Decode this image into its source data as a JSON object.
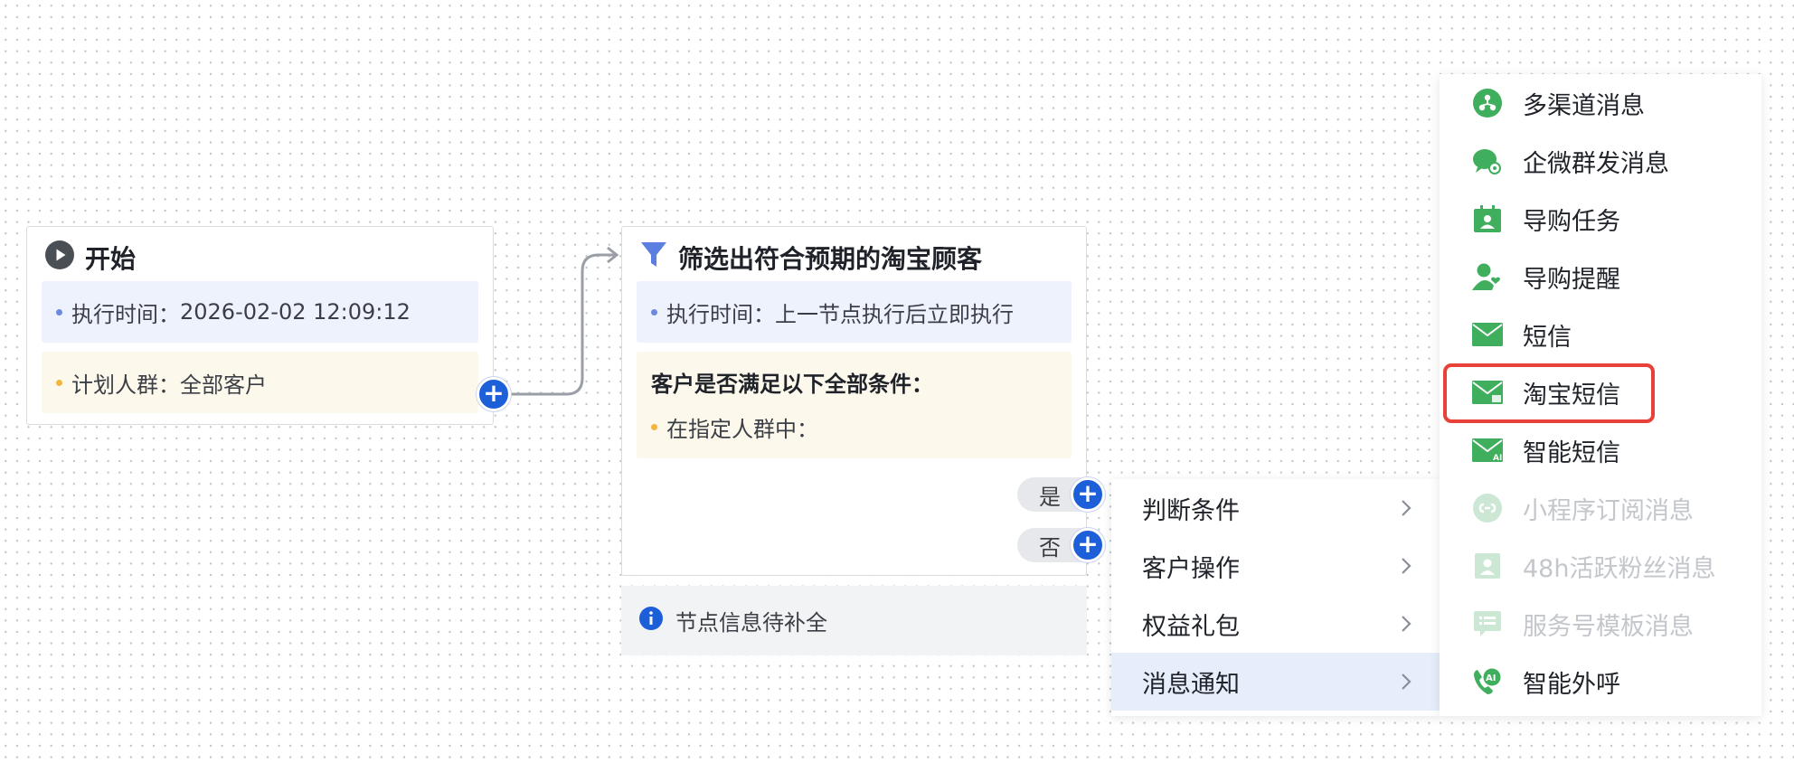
{
  "start_node": {
    "title": "开始",
    "exec_time_label": "执行时间：",
    "exec_time_value": "2026-02-02 12:09:12",
    "audience_label": "计划人群：",
    "audience_value": "全部客户"
  },
  "filter_node": {
    "title": "筛选出符合预期的淘宝顾客",
    "exec_time_label": "执行时间：",
    "exec_time_value": "上一节点执行后立即执行",
    "condition_heading": "客户是否满足以下全部条件：",
    "condition_item": "在指定人群中：",
    "branch_yes": "是",
    "branch_no": "否"
  },
  "info_bar": {
    "text": "节点信息待补全"
  },
  "menu_primary": {
    "items": [
      {
        "label": "判断条件"
      },
      {
        "label": "客户操作"
      },
      {
        "label": "权益礼包"
      },
      {
        "label": "消息通知",
        "active": true
      }
    ]
  },
  "menu_messages": {
    "items": [
      {
        "label": "多渠道消息",
        "icon": "multi-channel-icon",
        "enabled": true
      },
      {
        "label": "企微群发消息",
        "icon": "wecom-chat-icon",
        "enabled": true
      },
      {
        "label": "导购任务",
        "icon": "guide-task-icon",
        "enabled": true
      },
      {
        "label": "导购提醒",
        "icon": "guide-reminder-icon",
        "enabled": true
      },
      {
        "label": "短信",
        "icon": "envelope-icon",
        "enabled": true
      },
      {
        "label": "淘宝短信",
        "icon": "taobao-sms-icon",
        "enabled": true,
        "highlighted": true
      },
      {
        "label": "智能短信",
        "icon": "ai-sms-icon",
        "enabled": true
      },
      {
        "label": "小程序订阅消息",
        "icon": "miniprogram-icon",
        "enabled": false
      },
      {
        "label": "48h活跃粉丝消息",
        "icon": "active-fans-icon",
        "enabled": false
      },
      {
        "label": "服务号模板消息",
        "icon": "service-template-icon",
        "enabled": false
      },
      {
        "label": "智能外呼",
        "icon": "ai-call-icon",
        "enabled": true
      }
    ]
  },
  "colors": {
    "accent_blue": "#1c5fd8",
    "icon_green": "#3fae5d",
    "highlight_red": "#e8413a",
    "menu_active_bg": "#e6eefc"
  }
}
